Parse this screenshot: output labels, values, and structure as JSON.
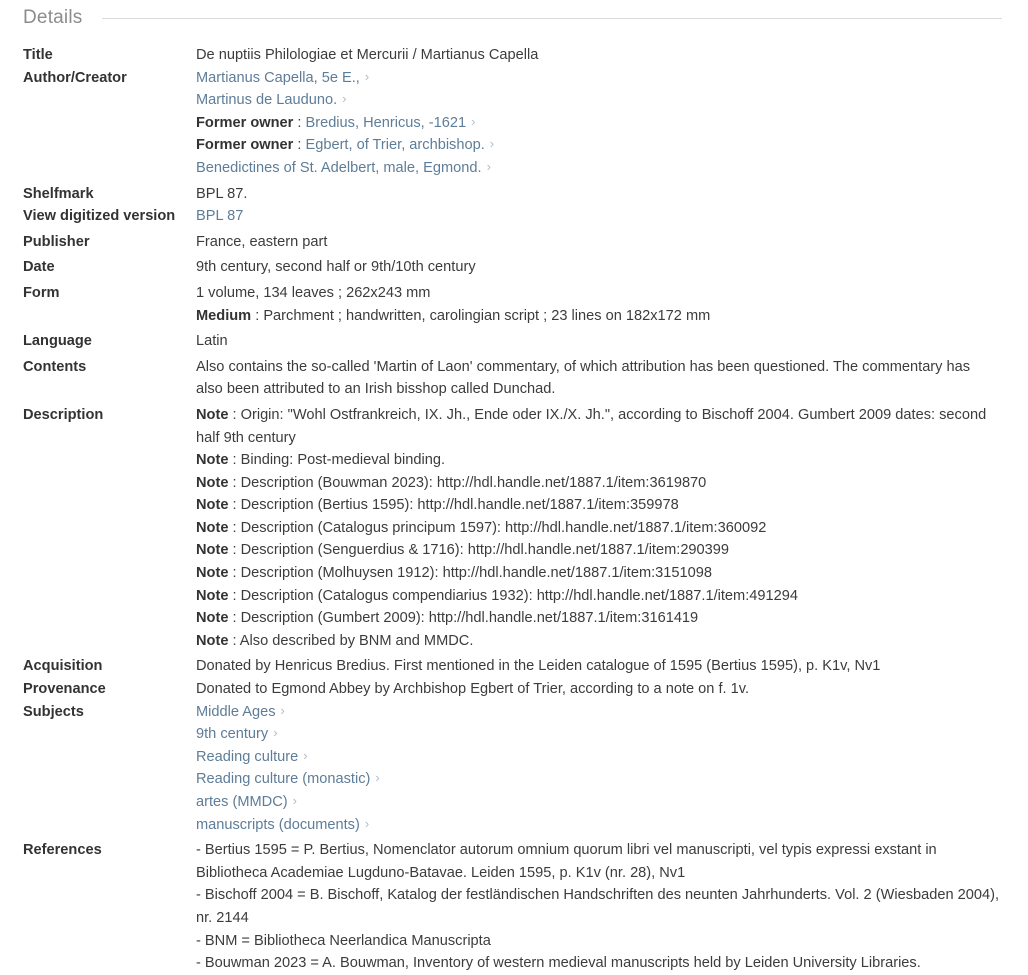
{
  "section": {
    "title": "Details"
  },
  "labels": {
    "title": "Title",
    "author": "Author/Creator",
    "shelfmark": "Shelfmark",
    "digitized": "View digitized version",
    "publisher": "Publisher",
    "date": "Date",
    "form": "Form",
    "language": "Language",
    "contents": "Contents",
    "description": "Description",
    "acquisition": "Acquisition",
    "provenance": "Provenance",
    "subjects": "Subjects",
    "references": "References"
  },
  "icons": {
    "chevron_right": "chevron-right-icon",
    "chevron_glyph": "›"
  },
  "colors": {
    "link": "#5e7d98",
    "label": "#333333",
    "text": "#3c3c3c",
    "header": "#8c8c8c",
    "rule": "#dcdcdc",
    "chevron": "#b0bcc6"
  },
  "values": {
    "title": "De nuptiis Philologiae et Mercurii / Martianus Capella",
    "authors": [
      {
        "prefix": "",
        "text": "Martianus Capella, 5e E.,",
        "link": true,
        "chevron": true
      },
      {
        "prefix": "",
        "text": "Martinus de Lauduno.",
        "link": true,
        "chevron": true
      },
      {
        "prefix": "Former owner",
        "text": "Bredius, Henricus, -1621",
        "link": true,
        "chevron": true
      },
      {
        "prefix": "Former owner",
        "text": "Egbert, of Trier, archbishop.",
        "link": true,
        "chevron": true
      },
      {
        "prefix": "",
        "text": "Benedictines of St. Adelbert, male, Egmond.",
        "link": true,
        "chevron": true
      }
    ],
    "shelfmark": "BPL 87.",
    "digitized": "BPL 87",
    "publisher": "France, eastern part",
    "date": "9th century, second half or 9th/10th century",
    "form_lines": [
      {
        "prefix": "",
        "text": "1 volume, 134 leaves ; 262x243 mm"
      },
      {
        "prefix": "Medium",
        "text": "Parchment ; handwritten, carolingian script ; 23 lines on 182x172 mm"
      }
    ],
    "language": "Latin",
    "contents": "Also contains the so-called 'Martin of Laon' commentary, of which attribution has been questioned. The commentary has also been attributed to an Irish bisshop called Dunchad.",
    "description_notes": [
      {
        "prefix": "Note",
        "text": "Origin: \"Wohl Ostfrankreich, IX. Jh., Ende oder IX./X. Jh.\", according to Bischoff 2004. Gumbert 2009 dates: second half 9th century"
      },
      {
        "prefix": "Note",
        "text": "Binding: Post-medieval binding."
      },
      {
        "prefix": "Note",
        "text": "Description (Bouwman 2023): http://hdl.handle.net/1887.1/item:3619870"
      },
      {
        "prefix": "Note",
        "text": "Description (Bertius 1595): http://hdl.handle.net/1887.1/item:359978"
      },
      {
        "prefix": "Note",
        "text": "Description (Catalogus principum 1597): http://hdl.handle.net/1887.1/item:360092"
      },
      {
        "prefix": "Note",
        "text": "Description (Senguerdius & 1716): http://hdl.handle.net/1887.1/item:290399"
      },
      {
        "prefix": "Note",
        "text": "Description (Molhuysen 1912): http://hdl.handle.net/1887.1/item:3151098"
      },
      {
        "prefix": "Note",
        "text": "Description (Catalogus compendiarius 1932): http://hdl.handle.net/1887.1/item:491294"
      },
      {
        "prefix": "Note",
        "text": "Description (Gumbert 2009): http://hdl.handle.net/1887.1/item:3161419"
      },
      {
        "prefix": "Note",
        "text": "Also described by BNM and MMDC."
      }
    ],
    "acquisition": "Donated by Henricus Bredius. First mentioned in the Leiden catalogue of 1595 (Bertius 1595), p. K1v, Nv1",
    "provenance": "Donated to Egmond Abbey by Archbishop Egbert of Trier, according to a note on f. 1v.",
    "subjects": [
      "Middle Ages",
      "9th century",
      "Reading culture",
      "Reading culture (monastic)",
      "artes (MMDC)",
      "manuscripts (documents)"
    ],
    "references": [
      "- Bertius 1595 = P. Bertius, Nomenclator autorum omnium quorum libri vel manuscripti, vel typis expressi exstant in Bibliotheca Academiae Lugduno-Batavae. Leiden 1595, p. K1v (nr. 28), Nv1",
      "- Bischoff 2004 = B. Bischoff, Katalog der festländischen Handschriften des neunten Jahrhunderts. Vol. 2 (Wiesbaden 2004), nr. 2144",
      "- BNM = Bibliotheca Neerlandica Manuscripta",
      "- Bouwman 2023 = A. Bouwman, Inventory of western medieval manuscripts held by Leiden University Libraries."
    ]
  }
}
